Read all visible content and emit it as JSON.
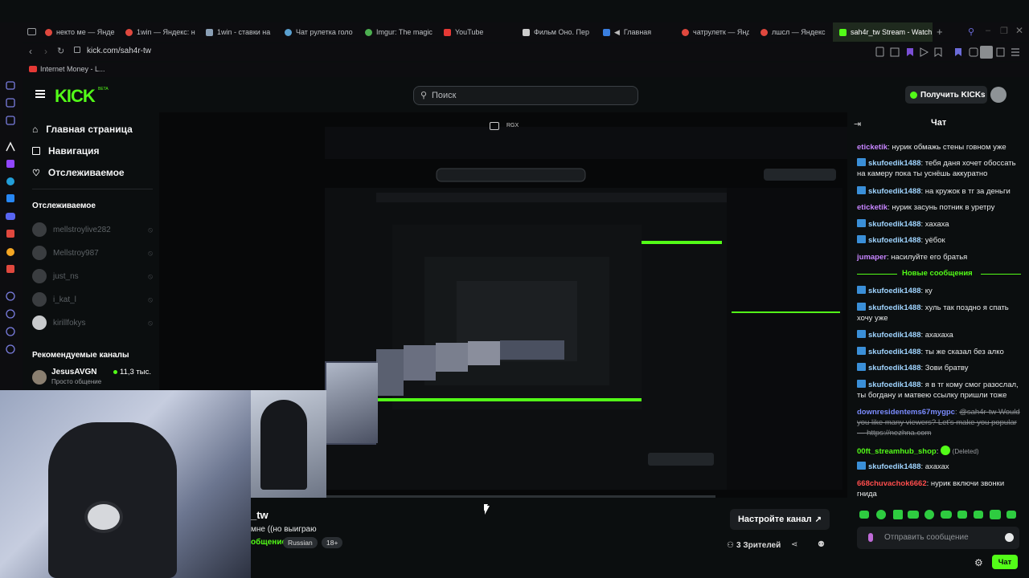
{
  "browser": {
    "tabs": [
      {
        "label": "некто ме — Янде",
        "color": "#e0483e"
      },
      {
        "label": "1win — Яндекс: н",
        "color": "#e0483e"
      },
      {
        "label": "1win - ставки на",
        "color": "#8a9fb5"
      },
      {
        "label": "Чат рулетка голо",
        "color": "#5aa0d0"
      },
      {
        "label": "Imgur: The magic",
        "color": "#4caf50"
      },
      {
        "label": "YouTube",
        "color": "#e53935"
      },
      {
        "label": "Фильм Оно. Пер",
        "color": "#cccccc"
      },
      {
        "label": "Главная",
        "color": "#3a7fe0"
      },
      {
        "label": "чатрулетк — Янд",
        "color": "#e0483e"
      },
      {
        "label": "лшсл — Яндекс",
        "color": "#e0483e"
      },
      {
        "label": "sah4r_tw Stream - Watch",
        "color": "#53fc18"
      }
    ],
    "url": "kick.com/sah4r-tw",
    "bookmark": "Internet Money - L..."
  },
  "kick": {
    "logo": "KICK",
    "logo_tag": "BETA",
    "search_placeholder": "Поиск",
    "get_kicks": "Получить KICKs"
  },
  "sidebar": {
    "nav": [
      {
        "label": "Главная страница",
        "icon": "home-icon"
      },
      {
        "label": "Навигация",
        "icon": "browse-icon"
      },
      {
        "label": "Отслеживаемое",
        "icon": "heart-icon"
      }
    ],
    "followed_title": "Отслеживаемое",
    "followed": [
      "mellstroylive282",
      "Mellstroy987",
      "just_ns",
      "i_kat_l",
      "kirillfokys"
    ],
    "recommended_title": "Рекомендуемые каналы",
    "recommended": [
      {
        "name": "JesusAVGN",
        "sub": "Просто общение",
        "viewers": "11,3 тыс."
      }
    ]
  },
  "stream": {
    "title_fragment": "_tw",
    "desc_fragment": "мне ((но выиграю",
    "category_fragment": "общение",
    "tags": [
      "Russian",
      "18+"
    ],
    "configure": "Настройте канал",
    "viewers": "3 Зрителей"
  },
  "chat": {
    "title": "Чат",
    "new_messages": "Новые сообщения",
    "messages": [
      {
        "user": "eticketik",
        "text": "нурик обмажь стены говном уже",
        "color": "#c785ff",
        "badge": false
      },
      {
        "user": "skufoedik1488",
        "text": "тебя даня хочет обоссать на камеру пока ты уснёшь аккуратно",
        "color": "#9fd4ff",
        "badge": true
      },
      {
        "user": "skufoedik1488",
        "text": "на кружок в тг за деньги",
        "color": "#9fd4ff",
        "badge": true
      },
      {
        "user": "eticketik",
        "text": "нурик засунь потник в уретру",
        "color": "#c785ff",
        "badge": false
      },
      {
        "user": "skufoedik1488",
        "text": "хахаха",
        "color": "#9fd4ff",
        "badge": true
      },
      {
        "user": "skufoedik1488",
        "text": "уёбок",
        "color": "#9fd4ff",
        "badge": true
      },
      {
        "user": "jumaper",
        "text": "насилуйте его братья",
        "color": "#c785ff",
        "badge": false
      },
      {
        "user": "skufoedik1488",
        "text": "ку",
        "color": "#9fd4ff",
        "badge": true
      },
      {
        "user": "skufoedik1488",
        "text": "хуль так поздно я спать хочу уже",
        "color": "#9fd4ff",
        "badge": true
      },
      {
        "user": "skufoedik1488",
        "text": "ахахаха",
        "color": "#9fd4ff",
        "badge": true
      },
      {
        "user": "skufoedik1488",
        "text": "ты же сказал без алко",
        "color": "#9fd4ff",
        "badge": true
      },
      {
        "user": "skufoedik1488",
        "text": "Зови братву",
        "color": "#9fd4ff",
        "badge": true
      },
      {
        "user": "skufoedik1488",
        "text": "я в тг кому смог разослал, ты богдану и матвею ссылку пришли тоже",
        "color": "#9fd4ff",
        "badge": true
      },
      {
        "user": "downresidentems67mygpc",
        "text": "@sah4r-tw Would you like many viewers? Let's make you popular — https://nezhna.com",
        "color": "#7b8cff",
        "badge": false,
        "deleted": true
      },
      {
        "user": "00ft_streamhub_shop",
        "text": "",
        "color": "#53fc18",
        "badge": false,
        "deleted": true
      },
      {
        "user": "skufoedik1488",
        "text": "ахахах",
        "color": "#9fd4ff",
        "badge": true
      },
      {
        "user": "668chuvachok6662",
        "text": "нурик включи звонки гнида",
        "color": "#ff4d4d",
        "badge": false
      }
    ],
    "deleted_label": "(Deleted)",
    "input_placeholder": "Отправить сообщение",
    "send": "Чат"
  },
  "colors": {
    "accent": "#53fc18",
    "bg": "#0b0e0f"
  }
}
